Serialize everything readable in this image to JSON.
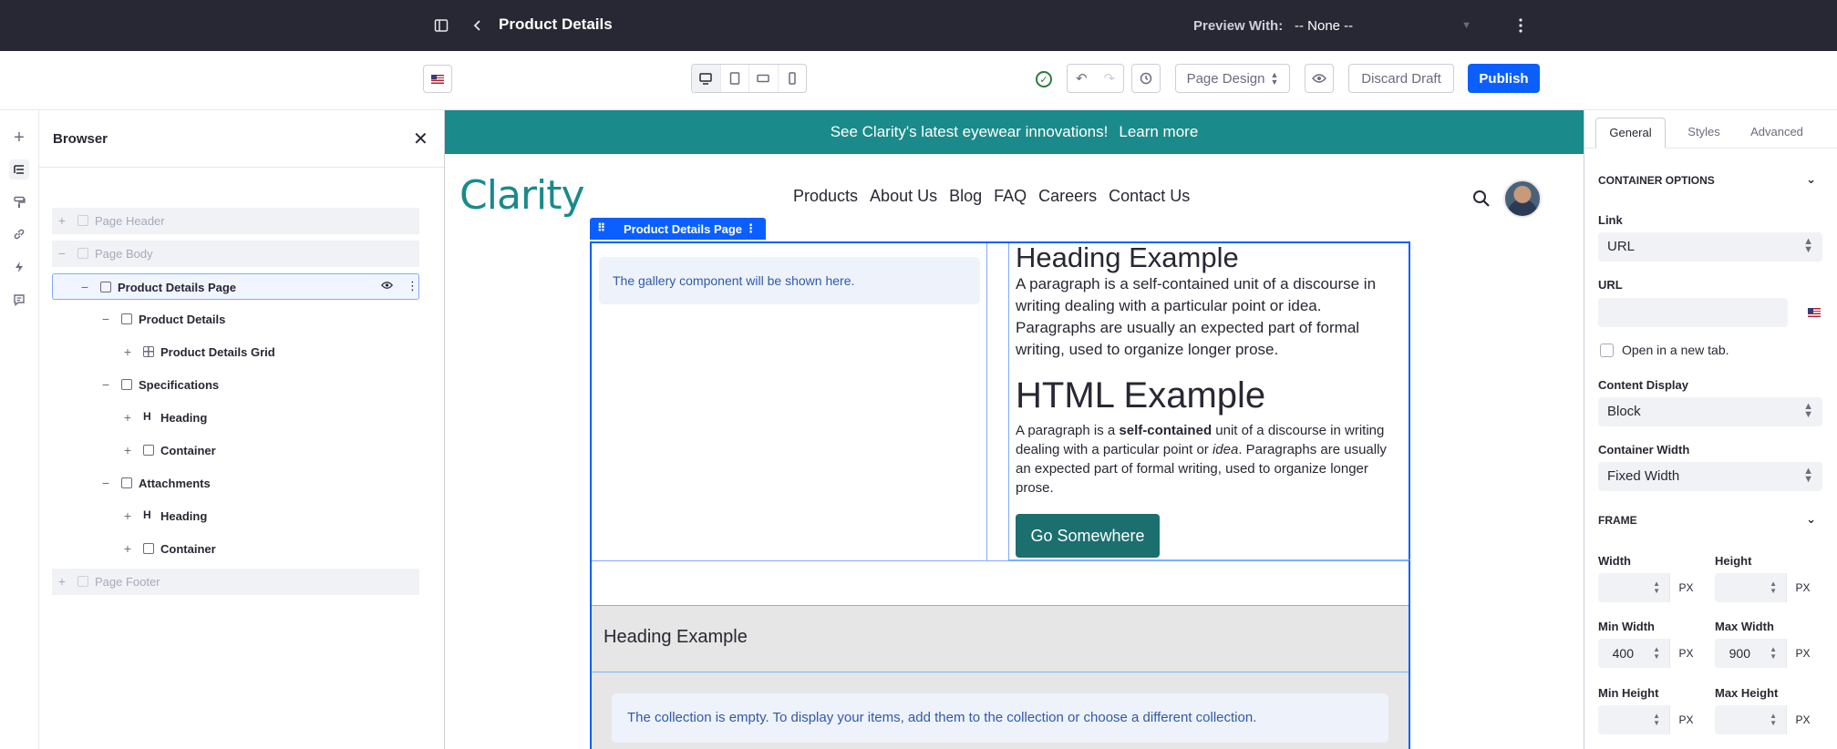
{
  "topbar": {
    "title": "Product Details",
    "preview_label": "Preview With:",
    "preview_value": "-- None --"
  },
  "toolbar": {
    "mode": "Page Design",
    "discard": "Discard Draft",
    "publish": "Publish",
    "devices": [
      "desktop",
      "tablet",
      "landscape-phone",
      "portrait-phone"
    ],
    "active_device": "desktop"
  },
  "browser": {
    "title": "Browser",
    "tree": [
      {
        "label": "Page Header",
        "toggle": "+",
        "icon": "container",
        "depth": 0,
        "dim": true
      },
      {
        "label": "Page Body",
        "toggle": "−",
        "icon": "container",
        "depth": 0,
        "dim": true
      },
      {
        "label": "Product Details Page",
        "toggle": "−",
        "icon": "container",
        "depth": 1,
        "selected": true
      },
      {
        "label": "Product Details",
        "toggle": "−",
        "icon": "container",
        "depth": 2
      },
      {
        "label": "Product Details Grid",
        "toggle": "+",
        "icon": "grid",
        "depth": 3
      },
      {
        "label": "Specifications",
        "toggle": "−",
        "icon": "container",
        "depth": 2
      },
      {
        "label": "Heading",
        "toggle": "+",
        "icon": "heading",
        "depth": 3
      },
      {
        "label": "Container",
        "toggle": "+",
        "icon": "container",
        "depth": 3
      },
      {
        "label": "Attachments",
        "toggle": "−",
        "icon": "container",
        "depth": 2
      },
      {
        "label": "Heading",
        "toggle": "+",
        "icon": "heading",
        "depth": 3
      },
      {
        "label": "Container",
        "toggle": "+",
        "icon": "container",
        "depth": 3
      },
      {
        "label": "Page Footer",
        "toggle": "+",
        "icon": "container",
        "depth": 0,
        "dim": true
      }
    ]
  },
  "canvas": {
    "banner_text": "See Clarity's latest eyewear innovations!",
    "banner_link": "Learn more",
    "logo": "Clarity",
    "nav": [
      "Products",
      "About Us",
      "Blog",
      "FAQ",
      "Careers",
      "Contact Us"
    ],
    "fragment_label": "Product Details Page",
    "gallery_msg": "The gallery component will be shown here.",
    "heading_example": "Heading Example",
    "paragraph": "A paragraph is a self-contained unit of a discourse in writing dealing with a particular point or idea. Paragraphs are usually an expected part of formal writing, used to organize longer prose.",
    "html_heading": "HTML Example",
    "html_p_1": "A paragraph is a ",
    "html_p_bold": "self-contained",
    "html_p_2": " unit of a discourse in writing dealing with a particular point or ",
    "html_p_italic": "idea",
    "html_p_3": ". Paragraphs are usually an expected part of formal writing, used to organize longer prose.",
    "button": "Go Somewhere",
    "section_heading": "Heading Example",
    "collection_msg": "The collection is empty. To display your items, add them to the collection or choose a different collection."
  },
  "panel": {
    "tabs": [
      "General",
      "Styles",
      "Advanced"
    ],
    "active_tab": "General",
    "container_options": "CONTAINER OPTIONS",
    "link_label": "Link",
    "link_value": "URL",
    "url_label": "URL",
    "url_value": "",
    "new_tab_label": "Open in a new tab.",
    "content_display_label": "Content Display",
    "content_display_value": "Block",
    "container_width_label": "Container Width",
    "container_width_value": "Fixed Width",
    "frame": "FRAME",
    "width_label": "Width",
    "height_label": "Height",
    "min_width_label": "Min Width",
    "min_width_value": "400",
    "max_width_label": "Max Width",
    "max_width_value": "900",
    "min_height_label": "Min Height",
    "max_height_label": "Max Height",
    "unit": "PX"
  },
  "colors": {
    "topbar": "#272833",
    "primary": "#0b5fff",
    "brand_teal": "#1b8a8a",
    "button_teal": "#1b6f6f"
  }
}
